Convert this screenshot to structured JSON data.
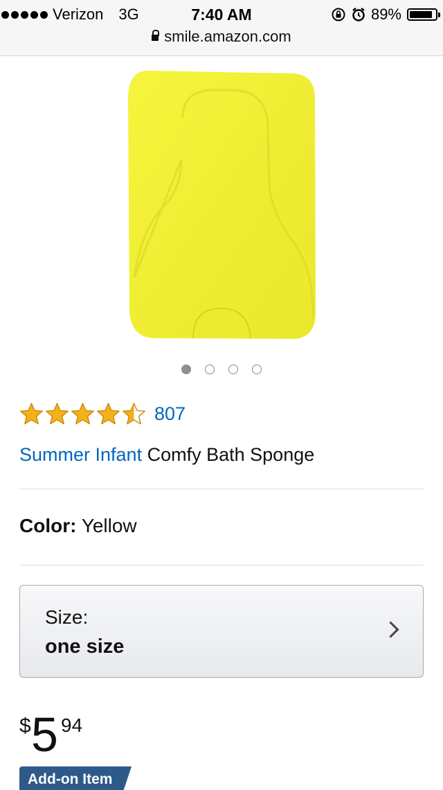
{
  "status_bar": {
    "carrier": "Verizon",
    "network": "3G",
    "time": "7:40 AM",
    "battery": "89%",
    "battery_level": 0.89,
    "icons": [
      "signal-dots-icon",
      "rotation-lock-icon",
      "alarm-icon",
      "battery-icon"
    ]
  },
  "browser": {
    "url": "smile.amazon.com",
    "secure_icon": "lock-icon"
  },
  "product": {
    "image_icon": "yellow-bath-sponge",
    "image_color": "#f2f03a",
    "carousel": {
      "total": 4,
      "active_index": 0
    },
    "rating": {
      "value": 4.5,
      "max": 5,
      "count": "807"
    },
    "brand": "Summer Infant",
    "name": "Comfy Bath Sponge",
    "color_label": "Color:",
    "color_value": "Yellow",
    "size_label": "Size:",
    "size_value": "one size",
    "price": {
      "currency": "$",
      "whole": "5",
      "fraction": "94"
    },
    "badge": "Add-on Item"
  },
  "colors": {
    "link_blue": "#0066c0",
    "star_gold": "#f6b01b",
    "badge_blue": "#2e5a8a"
  }
}
